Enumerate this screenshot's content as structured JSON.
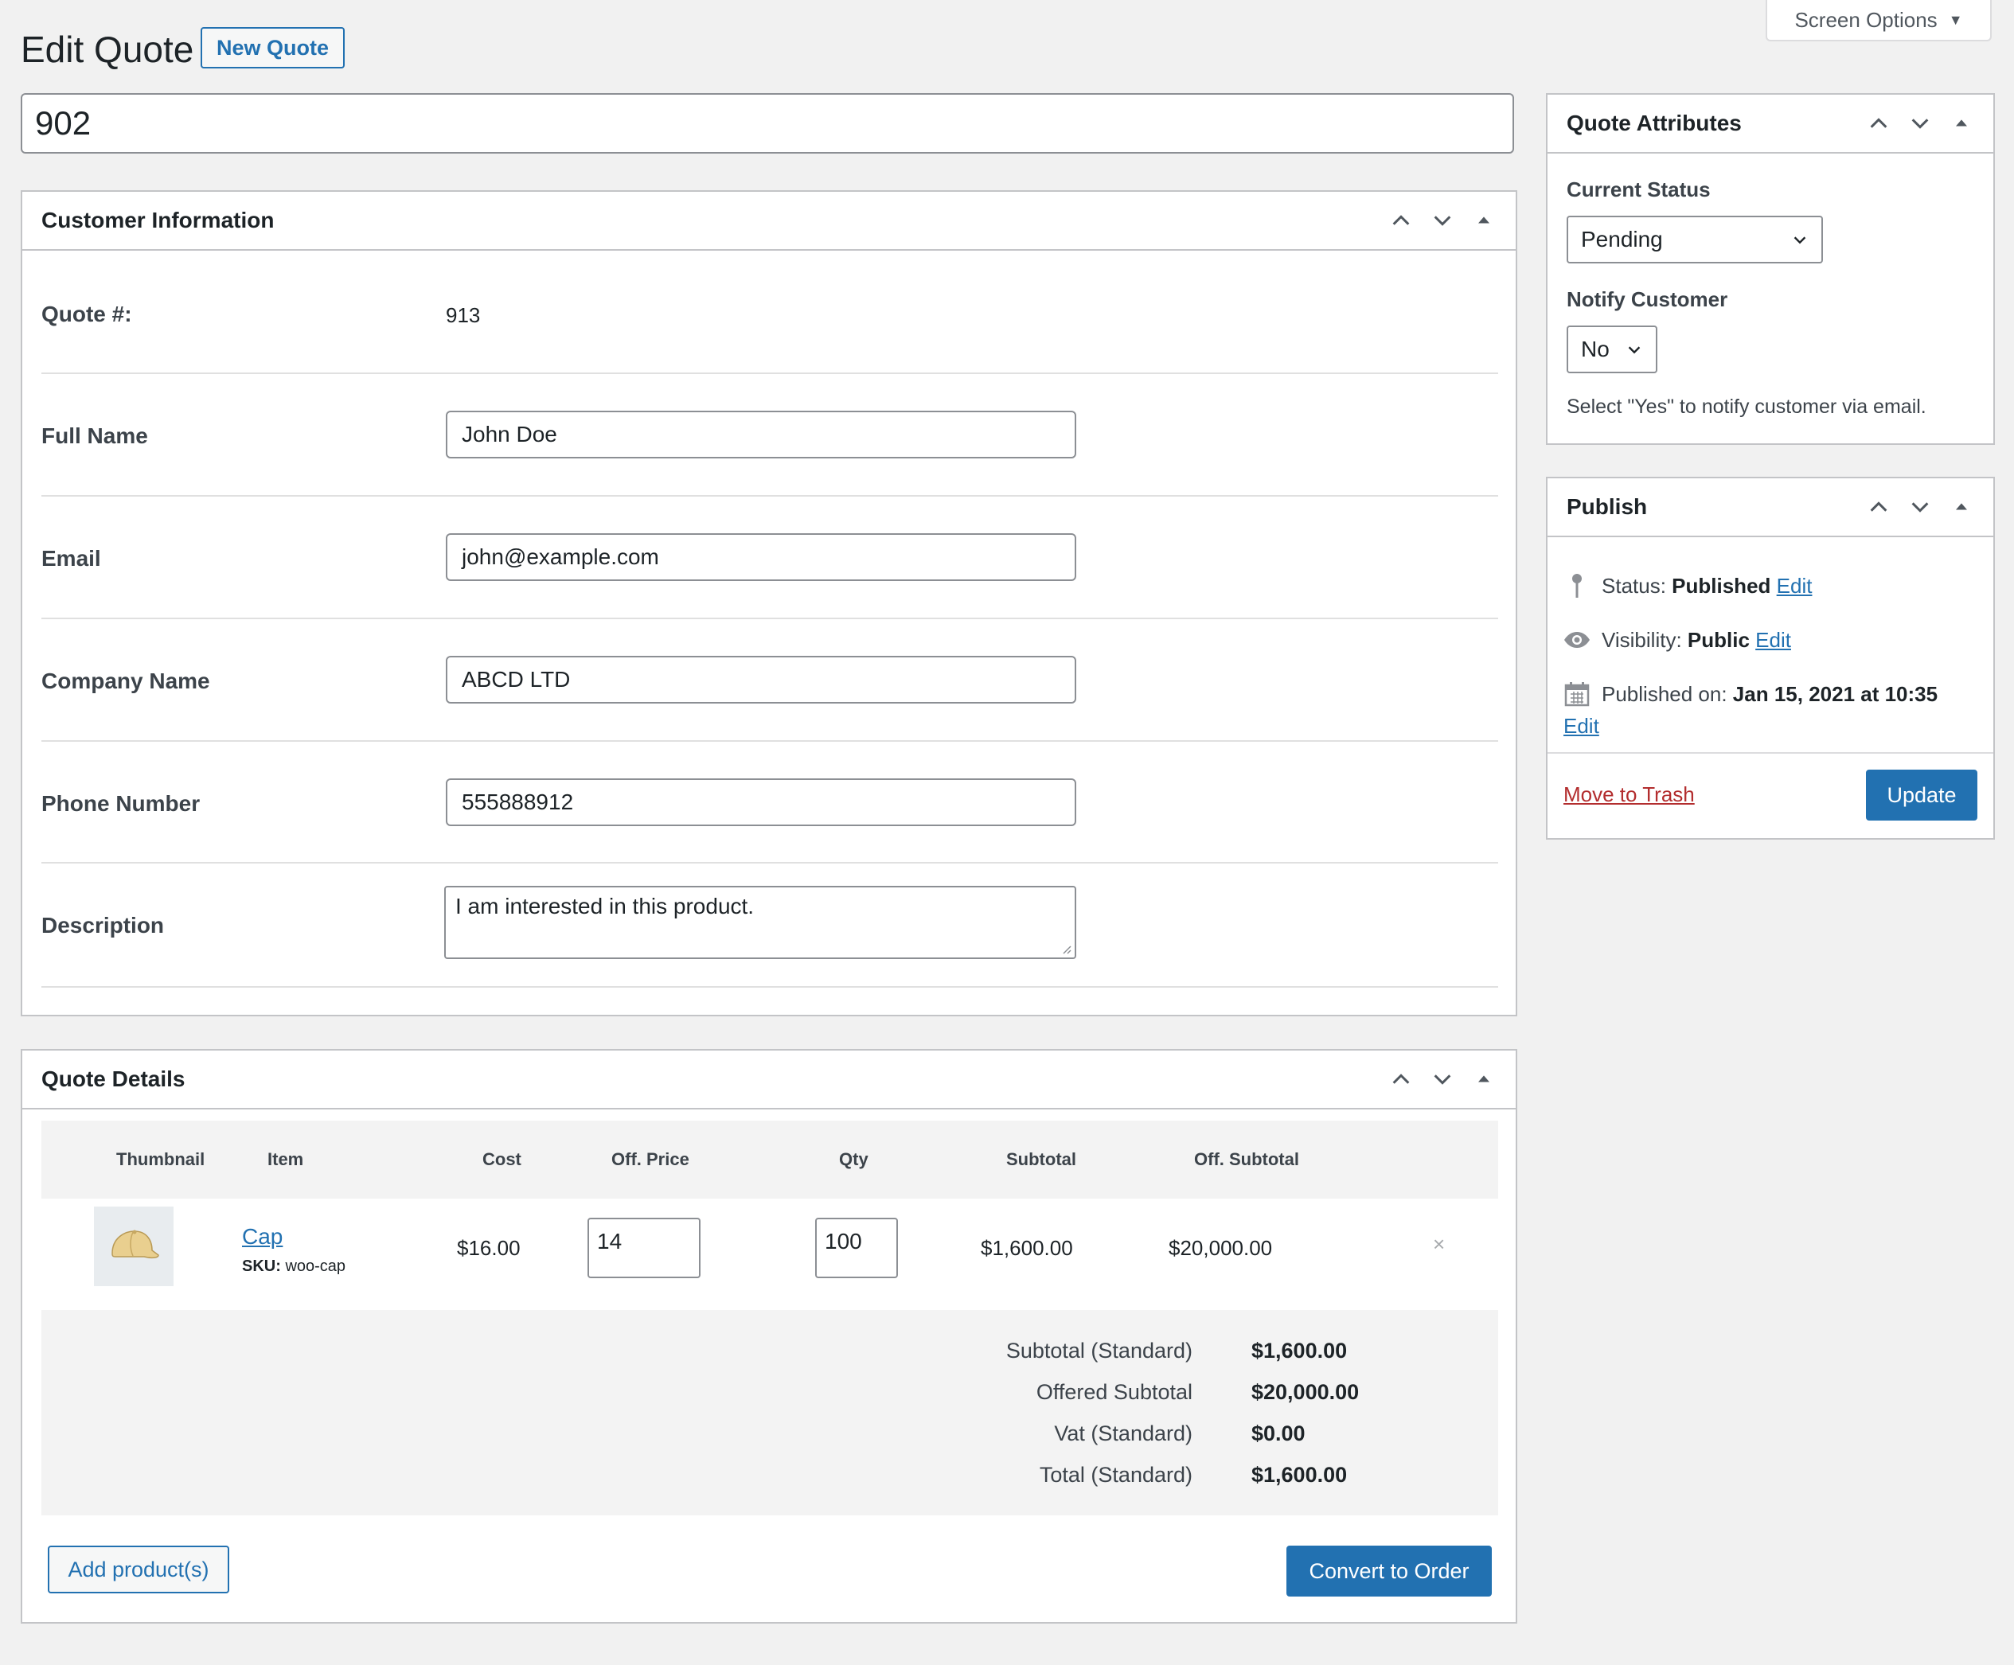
{
  "header": {
    "title": "Edit Quote",
    "new_quote_label": "New Quote",
    "screen_options_label": "Screen Options"
  },
  "post_title": "902",
  "customer_info": {
    "title": "Customer Information",
    "quote_label": "Quote #:",
    "quote_value": "913",
    "full_name_label": "Full Name",
    "full_name_value": "John Doe",
    "email_label": "Email",
    "email_value": "john@example.com",
    "company_label": "Company Name",
    "company_value": "ABCD LTD",
    "phone_label": "Phone Number",
    "phone_value": "555888912",
    "description_label": "Description",
    "description_value": "I am interested in this product."
  },
  "quote_details": {
    "title": "Quote Details",
    "columns": [
      "Thumbnail",
      "Item",
      "Cost",
      "Off. Price",
      "Qty",
      "Subtotal",
      "Off. Subtotal"
    ],
    "items": [
      {
        "name": "Cap",
        "sku_label": "SKU:",
        "sku": "woo-cap",
        "cost": "$16.00",
        "offered_price": "14",
        "qty": "100",
        "subtotal": "$1,600.00",
        "offered_subtotal": "$20,000.00",
        "remove_symbol": "×"
      }
    ],
    "totals": [
      {
        "label": "Subtotal (Standard)",
        "value": "$1,600.00"
      },
      {
        "label": "Offered Subtotal",
        "value": "$20,000.00"
      },
      {
        "label": "Vat (Standard)",
        "value": "$0.00"
      },
      {
        "label": "Total (Standard)",
        "value": "$1,600.00"
      }
    ],
    "add_products_label": "Add product(s)",
    "convert_label": "Convert to Order"
  },
  "quote_attributes": {
    "title": "Quote Attributes",
    "current_status_label": "Current Status",
    "current_status_value": "Pending",
    "notify_label": "Notify Customer",
    "notify_value": "No",
    "help_text": "Select \"Yes\" to notify customer via email."
  },
  "publish": {
    "title": "Publish",
    "status_label": "Status:",
    "status_value": "Published",
    "visibility_label": "Visibility:",
    "visibility_value": "Public",
    "published_label": "Published on:",
    "published_value": "Jan 15, 2021 at 10:35",
    "edit_label": "Edit",
    "trash_label": "Move to Trash",
    "update_label": "Update"
  }
}
